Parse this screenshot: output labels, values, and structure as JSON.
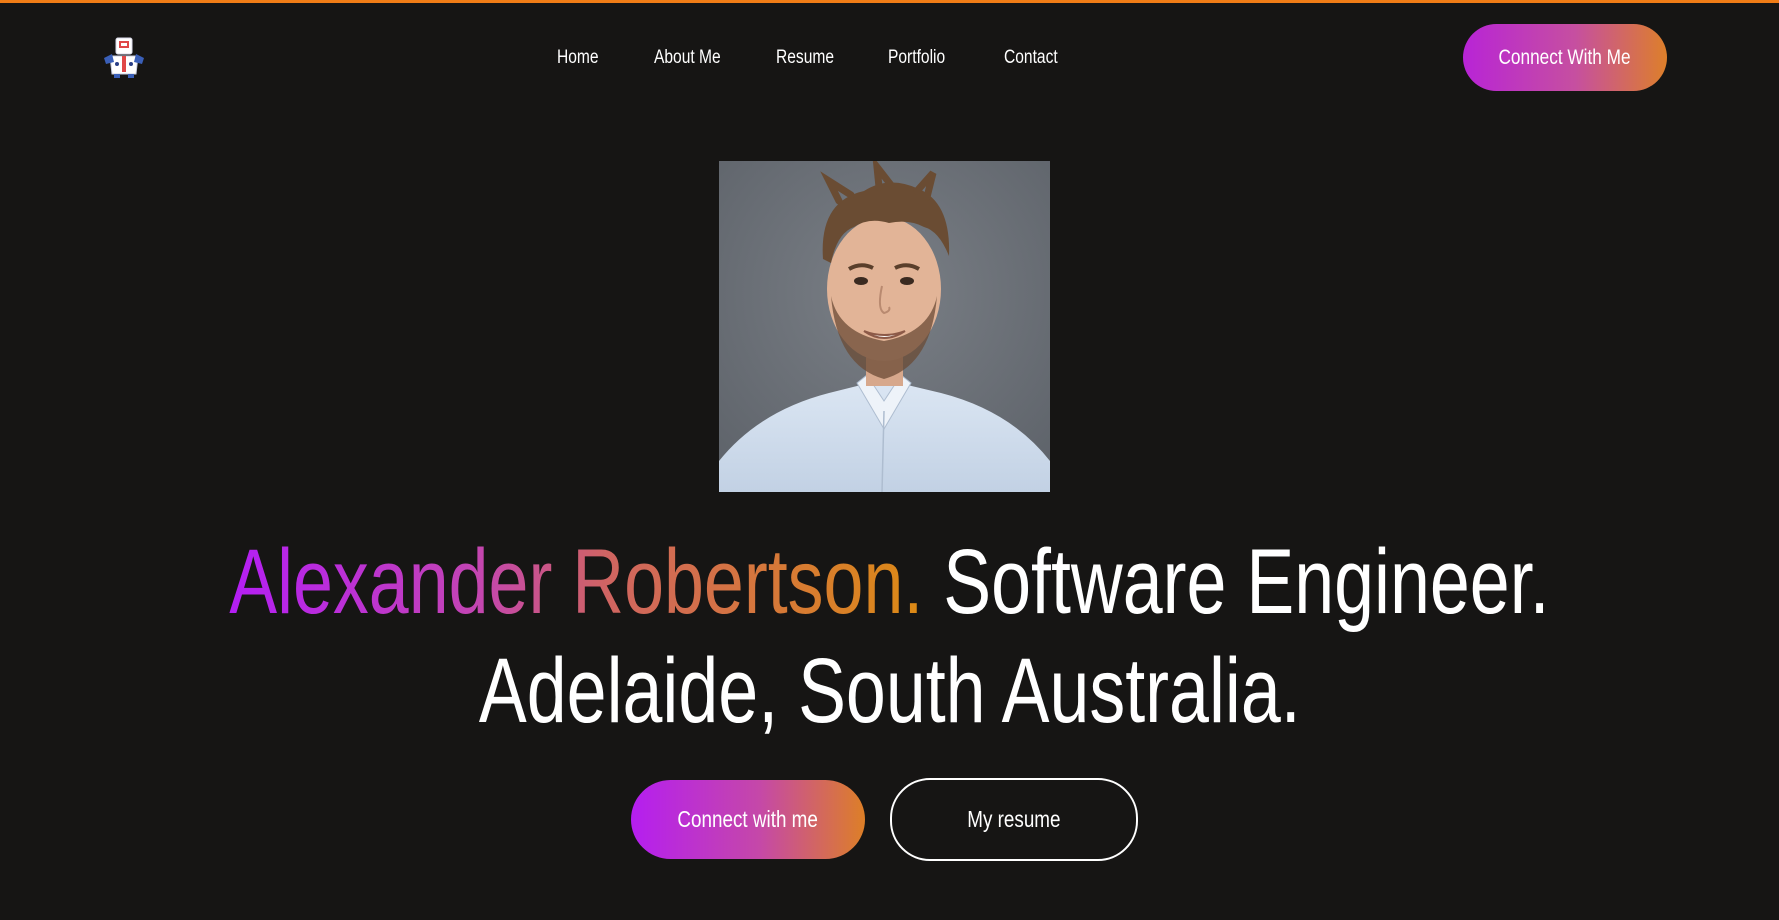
{
  "colors": {
    "background": "#161514",
    "top_accent": "#f07c16",
    "gradient_start": "#b41ef5",
    "gradient_end": "#dc8a14",
    "text": "#ffffff"
  },
  "header": {
    "logo_icon": "robot-mascot-icon",
    "nav": [
      "Home",
      "About Me",
      "Resume",
      "Portfolio",
      "Contact"
    ],
    "cta_label": "Connect With Me"
  },
  "hero": {
    "portrait_alt": "profile-photo",
    "name": "Alexander Robertson.",
    "title_suffix": " Software Engineer.",
    "location": "Adelaide, South Australia.",
    "primary_button": "Connect with me",
    "secondary_button": "My resume"
  }
}
